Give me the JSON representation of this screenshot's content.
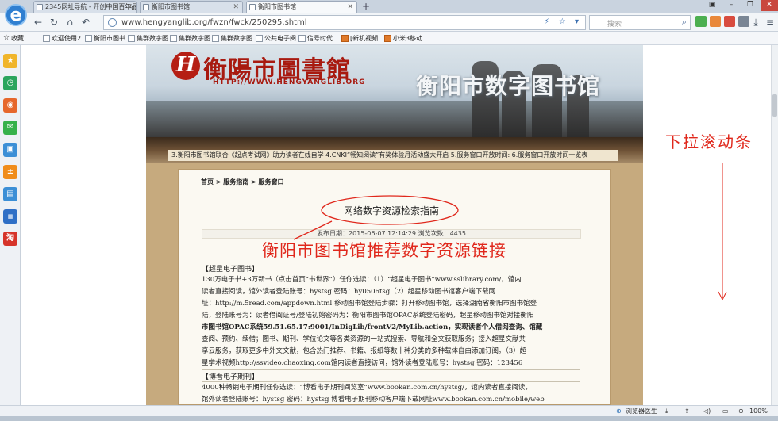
{
  "tabs": [
    {
      "title": "2345网址导航 - 开创中国百年品"
    },
    {
      "title": "衡阳市图书馆"
    },
    {
      "title": "衡阳市图书馆"
    }
  ],
  "address": {
    "url": "www.hengyanglib.org/fwzn/fwck/250295.shtml"
  },
  "search": {
    "placeholder": "搜索"
  },
  "bookmarks": [
    {
      "label": "收藏"
    },
    {
      "label": "欢迎使用2"
    },
    {
      "label": "衡阳市图书"
    },
    {
      "label": "集群数字图"
    },
    {
      "label": "集群数字图"
    },
    {
      "label": "集群数字图"
    },
    {
      "label": "公共电子阅"
    },
    {
      "label": "信号时代"
    },
    {
      "label": "[新机视频"
    },
    {
      "label": "小米3移动"
    }
  ],
  "site": {
    "logo_text": "衡陽市圖書館",
    "logo_url": "HTTP://WWW.HENGYANGLIB.ORG",
    "banner_title": "衡阳市数字图书馆",
    "ticker": "3.衡阳市图书馆联合《起点考试网》助力读者在线自学      4.CNKI“畅知阅读”有奖体验月活动盛大开启      5.服务窗口开放时间:      6.服务窗口开放时间一览表"
  },
  "article": {
    "breadcrumb": "首页 > 服务指南 > 服务窗口",
    "title": "网络数字资源检索指南",
    "meta": "发布日期：2015-06-07 12:14:29  浏览次数：4435",
    "section1_heading": "【超星电子图书】",
    "section1_lines": [
      "130万电子书+3万新书（点击首页“书世界”）任你选读：（1）“超星电子图书”www.sslibrary.com/，馆内",
      "读者直接阅读，馆外读者登陆账号：hystsg 密码：hy0506tsg（2）超星移动图书馆客户端下载网",
      "址：http://m.5read.com/appdown.html  移动图书馆登陆步骤：打开移动图书馆，选择湖南省衡阳市图书馆登",
      "陆，登陆账号为：读者借阅证号/登陆初始密码为：衡阳市图书馆OPAC系统登陆密码，超星移动图书馆对接衡阳",
      "市图书馆OPAC系统59.51.65.17:9001/InDigLib/frontV2/MyLib.action，实现读者个人借阅查询、馆藏",
      "查阅、预约、续借；图书、期刊、学位论文等各类资源的一站式搜索、导航和全文获取服务；接入超星文献共",
      "享云服务，获取更多中外文文献，包含热门推荐、书籍、报纸等数十种分类的多种载体自由添加订阅。（3）超",
      "星学术视频http://ssvideo.chaoxing.com馆内读者直接访问，馆外读者登陆账号：hystsg 密码：123456"
    ],
    "section2_heading": "【博看电子期刊】",
    "section2_lines": [
      "4000种畅销电子期刊任你选读：“博看电子期刊阅览室”www.bookan.com.cn/hystsg/，馆内读者直接阅读，",
      "馆外读者登陆账号：hystsg 密码：hystsg 博看电子期刊移动客户端下载网址www.bookan.com.cn/mobile/web"
    ]
  },
  "annotations": {
    "recommend": "衡阳市图书馆推荐数字资源链接",
    "scroll": "下拉滚动条"
  },
  "statusbar": {
    "accelerator": "浏览器医生",
    "zoom": "100%"
  }
}
